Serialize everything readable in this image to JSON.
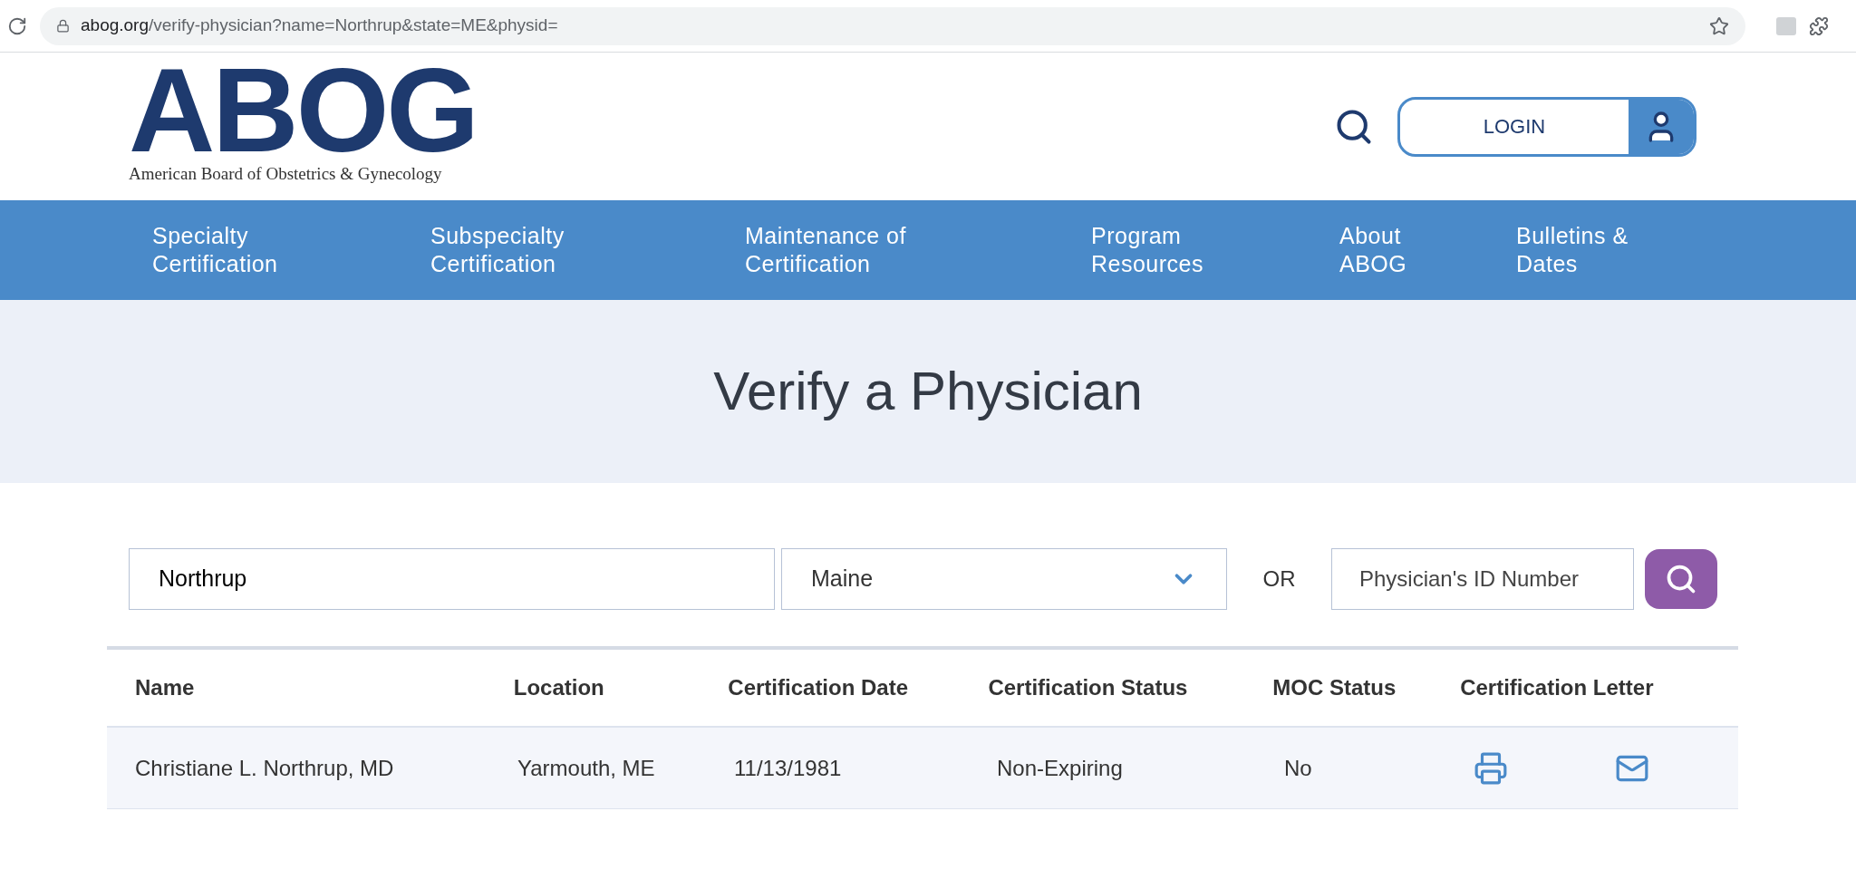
{
  "browser": {
    "url_host": "abog.org",
    "url_path": "/verify-physician?name=Northrup&state=ME&physid="
  },
  "header": {
    "logo_mark": "ABOG",
    "logo_subtitle": "American Board of Obstetrics & Gynecology",
    "login_label": "LOGIN"
  },
  "nav": [
    "Specialty Certification",
    "Subspecialty Certification",
    "Maintenance of Certification",
    "Program Resources",
    "About ABOG",
    "Bulletins & Dates"
  ],
  "hero": {
    "title": "Verify a Physician"
  },
  "search": {
    "name_value": "Northrup",
    "state_value": "Maine",
    "or_label": "OR",
    "id_placeholder": "Physician's ID Number"
  },
  "table": {
    "columns": [
      "Name",
      "Location",
      "Certification Date",
      "Certification Status",
      "MOC Status",
      "Certification Letter"
    ],
    "rows": [
      {
        "name": "Christiane L. Northrup, MD",
        "location": "Yarmouth, ME",
        "date": "11/13/1981",
        "status": "Non-Expiring",
        "moc": "No"
      }
    ]
  }
}
